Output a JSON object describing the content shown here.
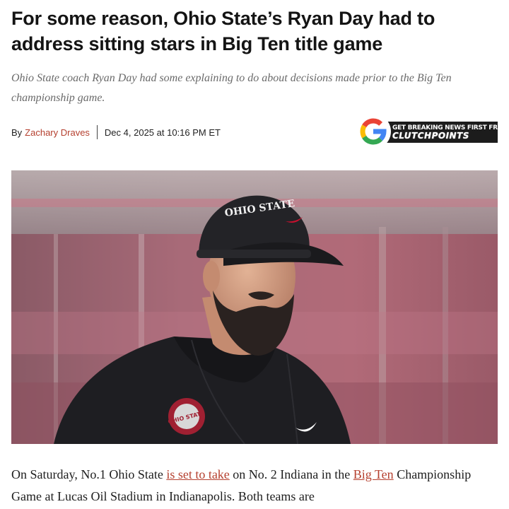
{
  "article": {
    "headline": "For some reason, Ohio State’s Ryan Day had to address sitting stars in Big Ten title game",
    "dek": "Ohio State coach Ryan Day had some explaining to do about decisions made prior to the Big Ten championship game.",
    "byline": {
      "prefix": "By",
      "author": "Zachary Draves",
      "date": "Dec 4, 2025 at 10:16 PM ET"
    },
    "hero_image": {
      "cap_text": "OHIO STATE",
      "logo_text": "OHIO STATE"
    },
    "body": {
      "p1_a": "On Saturday, No.1 Ohio State ",
      "p1_link1": "is set to take",
      "p1_b": " on No. 2 Indiana in the ",
      "p1_link2": "Big Ten",
      "p1_c": " Championship Game at Lucas Oil Stadium in Indianapolis. Both teams are"
    }
  },
  "promo": {
    "line1": "GET BREAKING NEWS FIRST FROM",
    "line2": "CLUTCHPOINTS",
    "icon": "google-g-icon"
  },
  "colors": {
    "link": "#b5402f",
    "dek": "#6a6a6a",
    "promo_bg": "#1c1c1c"
  }
}
